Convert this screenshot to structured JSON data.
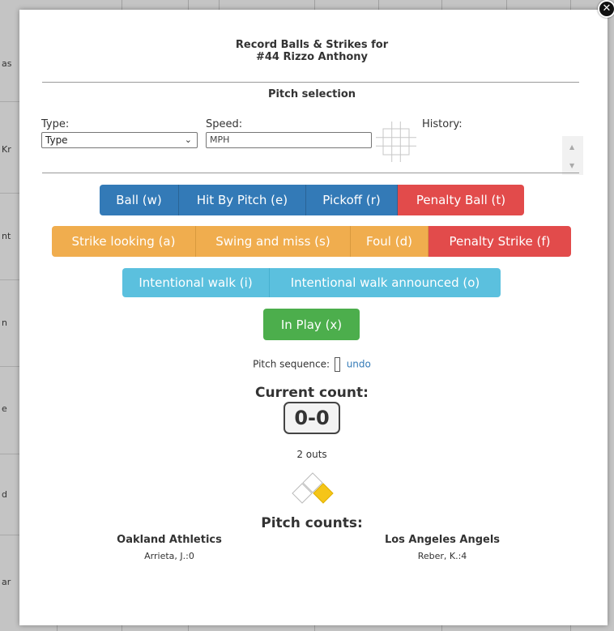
{
  "background": {
    "fragments": [
      "as",
      "Kr",
      "nt",
      "n",
      "e",
      "d",
      "ar"
    ]
  },
  "modal": {
    "close_icon": "close-icon",
    "title_line1": "Record Balls & Strikes for",
    "title_line2": "#44 Rizzo Anthony",
    "pitch_selection_title": "Pitch selection",
    "type_label": "Type:",
    "type_select_value": "Type",
    "speed_label": "Speed:",
    "speed_placeholder": "MPH",
    "history_label": "History:",
    "strike_zone_icon": "strike-zone-grid-icon",
    "buttons_row1": [
      {
        "label": "Ball (w)",
        "color": "#337ab7"
      },
      {
        "label": "Hit By Pitch (e)",
        "color": "#337ab7"
      },
      {
        "label": "Pickoff (r)",
        "color": "#337ab7"
      },
      {
        "label": "Penalty Ball (t)",
        "color": "#e24b4b"
      }
    ],
    "buttons_row2": [
      {
        "label": "Strike looking (a)",
        "color": "#f0ad4e"
      },
      {
        "label": "Swing and miss (s)",
        "color": "#f0ad4e"
      },
      {
        "label": "Foul (d)",
        "color": "#f0ad4e"
      },
      {
        "label": "Penalty Strike (f)",
        "color": "#e24b4b"
      }
    ],
    "buttons_row3": [
      {
        "label": "Intentional walk (i)",
        "color": "#5bc0de"
      },
      {
        "label": "Intentional walk announced (o)",
        "color": "#5bc0de"
      }
    ],
    "in_play_label": "In Play (x)",
    "in_play_color": "#4cae4c",
    "pitch_sequence_label": "Pitch sequence:",
    "undo_label": "undo",
    "current_count_title": "Current count:",
    "current_count": "0-0",
    "outs_text": "2 outs",
    "bases_icon": "bases-diamond-icon",
    "runner_on": "first",
    "pitch_counts_title": "Pitch counts:",
    "teams": [
      {
        "name": "Oakland Athletics",
        "pitcher": "Arrieta, J.:0"
      },
      {
        "name": "Los Angeles Angels",
        "pitcher": "Reber, K.:4"
      }
    ]
  }
}
